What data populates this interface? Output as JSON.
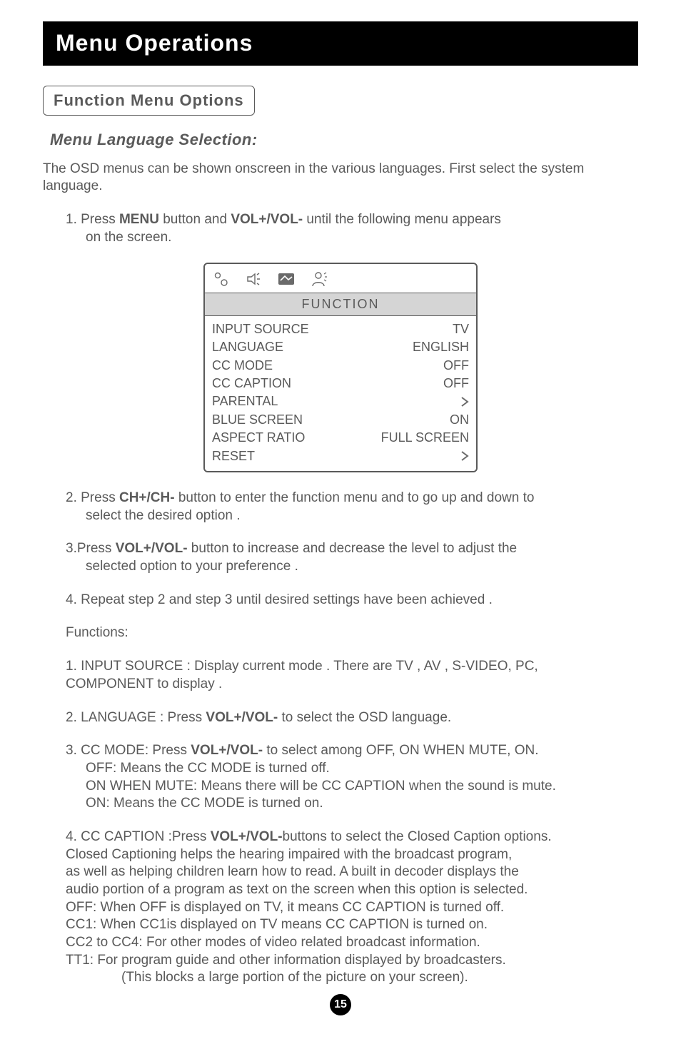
{
  "title": "Menu Operations",
  "section_label": "Function Menu Options",
  "subheading": "Menu Language Selection:",
  "intro": "The OSD menus can be shown onscreen in the various languages. First select the system language.",
  "step1_pre": "1. Press ",
  "step1_b1": "MENU",
  "step1_mid": " button and ",
  "step1_b2": "VOL+/VOL-",
  "step1_post": " until the following menu appears",
  "step1_line2": "on the screen.",
  "osd": {
    "header": "FUNCTION",
    "rows": {
      "r0": {
        "label": "INPUT SOURCE",
        "value": "TV"
      },
      "r1": {
        "label": "LANGUAGE",
        "value": "ENGLISH"
      },
      "r2": {
        "label": "CC MODE",
        "value": "OFF"
      },
      "r3": {
        "label": "CC CAPTION",
        "value": "OFF"
      },
      "r4": {
        "label": "PARENTAL"
      },
      "r5": {
        "label": "BLUE SCREEN",
        "value": "ON"
      },
      "r6": {
        "label": "ASPECT RATIO",
        "value": "FULL SCREEN"
      },
      "r7": {
        "label": "RESET"
      }
    }
  },
  "step2_pre": "2. Press ",
  "step2_b": "CH+/CH-",
  "step2_post": " button to enter the function menu and to go up and down to",
  "step2_line2": "select the desired option .",
  "step3_pre": "3.Press ",
  "step3_b": "VOL+/VOL-",
  "step3_post": " button to increase and decrease the level to adjust the",
  "step3_line2": "selected option to your preference .",
  "step4": "4. Repeat step 2 and step 3 until desired settings have been achieved .",
  "functions_label": "Functions:",
  "fn1_l1": "1. INPUT SOURCE : Display current mode . There are TV , AV , S-VIDEO, PC,",
  "fn1_l2": "COMPONENT to display .",
  "fn2_pre": "2. LANGUAGE : Press ",
  "fn2_b": "VOL+/VOL-",
  "fn2_post": " to select the OSD language.",
  "fn3_pre": "3. CC MODE: Press ",
  "fn3_b": "VOL+/VOL-",
  "fn3_post": " to select among OFF, ON WHEN MUTE, ON.",
  "fn3_l2": "OFF: Means the CC MODE is turned off.",
  "fn3_l3": "ON WHEN MUTE: Means there will be CC CAPTION when the sound is mute.",
  "fn3_l4": "ON: Means the CC MODE is turned on.",
  "fn4_pre": "4. CC CAPTION :Press ",
  "fn4_b": "VOL+/VOL-",
  "fn4_post": "buttons to select the Closed Caption options.",
  "fn4_l2": "Closed Captioning helps the hearing impaired with the broadcast program,",
  "fn4_l3": "as well as helping children learn how to read.  A built in decoder displays the",
  "fn4_l4": "audio portion of a program as text on the screen when this  option is selected.",
  "fn4_l5": "OFF:  When OFF is displayed on TV, it means CC CAPTION is turned off.",
  "fn4_l6": "CC1:  When CC1is displayed on TV means CC CAPTION is turned on.",
  "fn4_l7": "CC2 to CC4: For other modes of video related broadcast information.",
  "fn4_l8": "TT1: For program guide and other information displayed by broadcasters.",
  "fn4_l9": "(This blocks a large portion of the picture on your screen).",
  "page_number": "15"
}
